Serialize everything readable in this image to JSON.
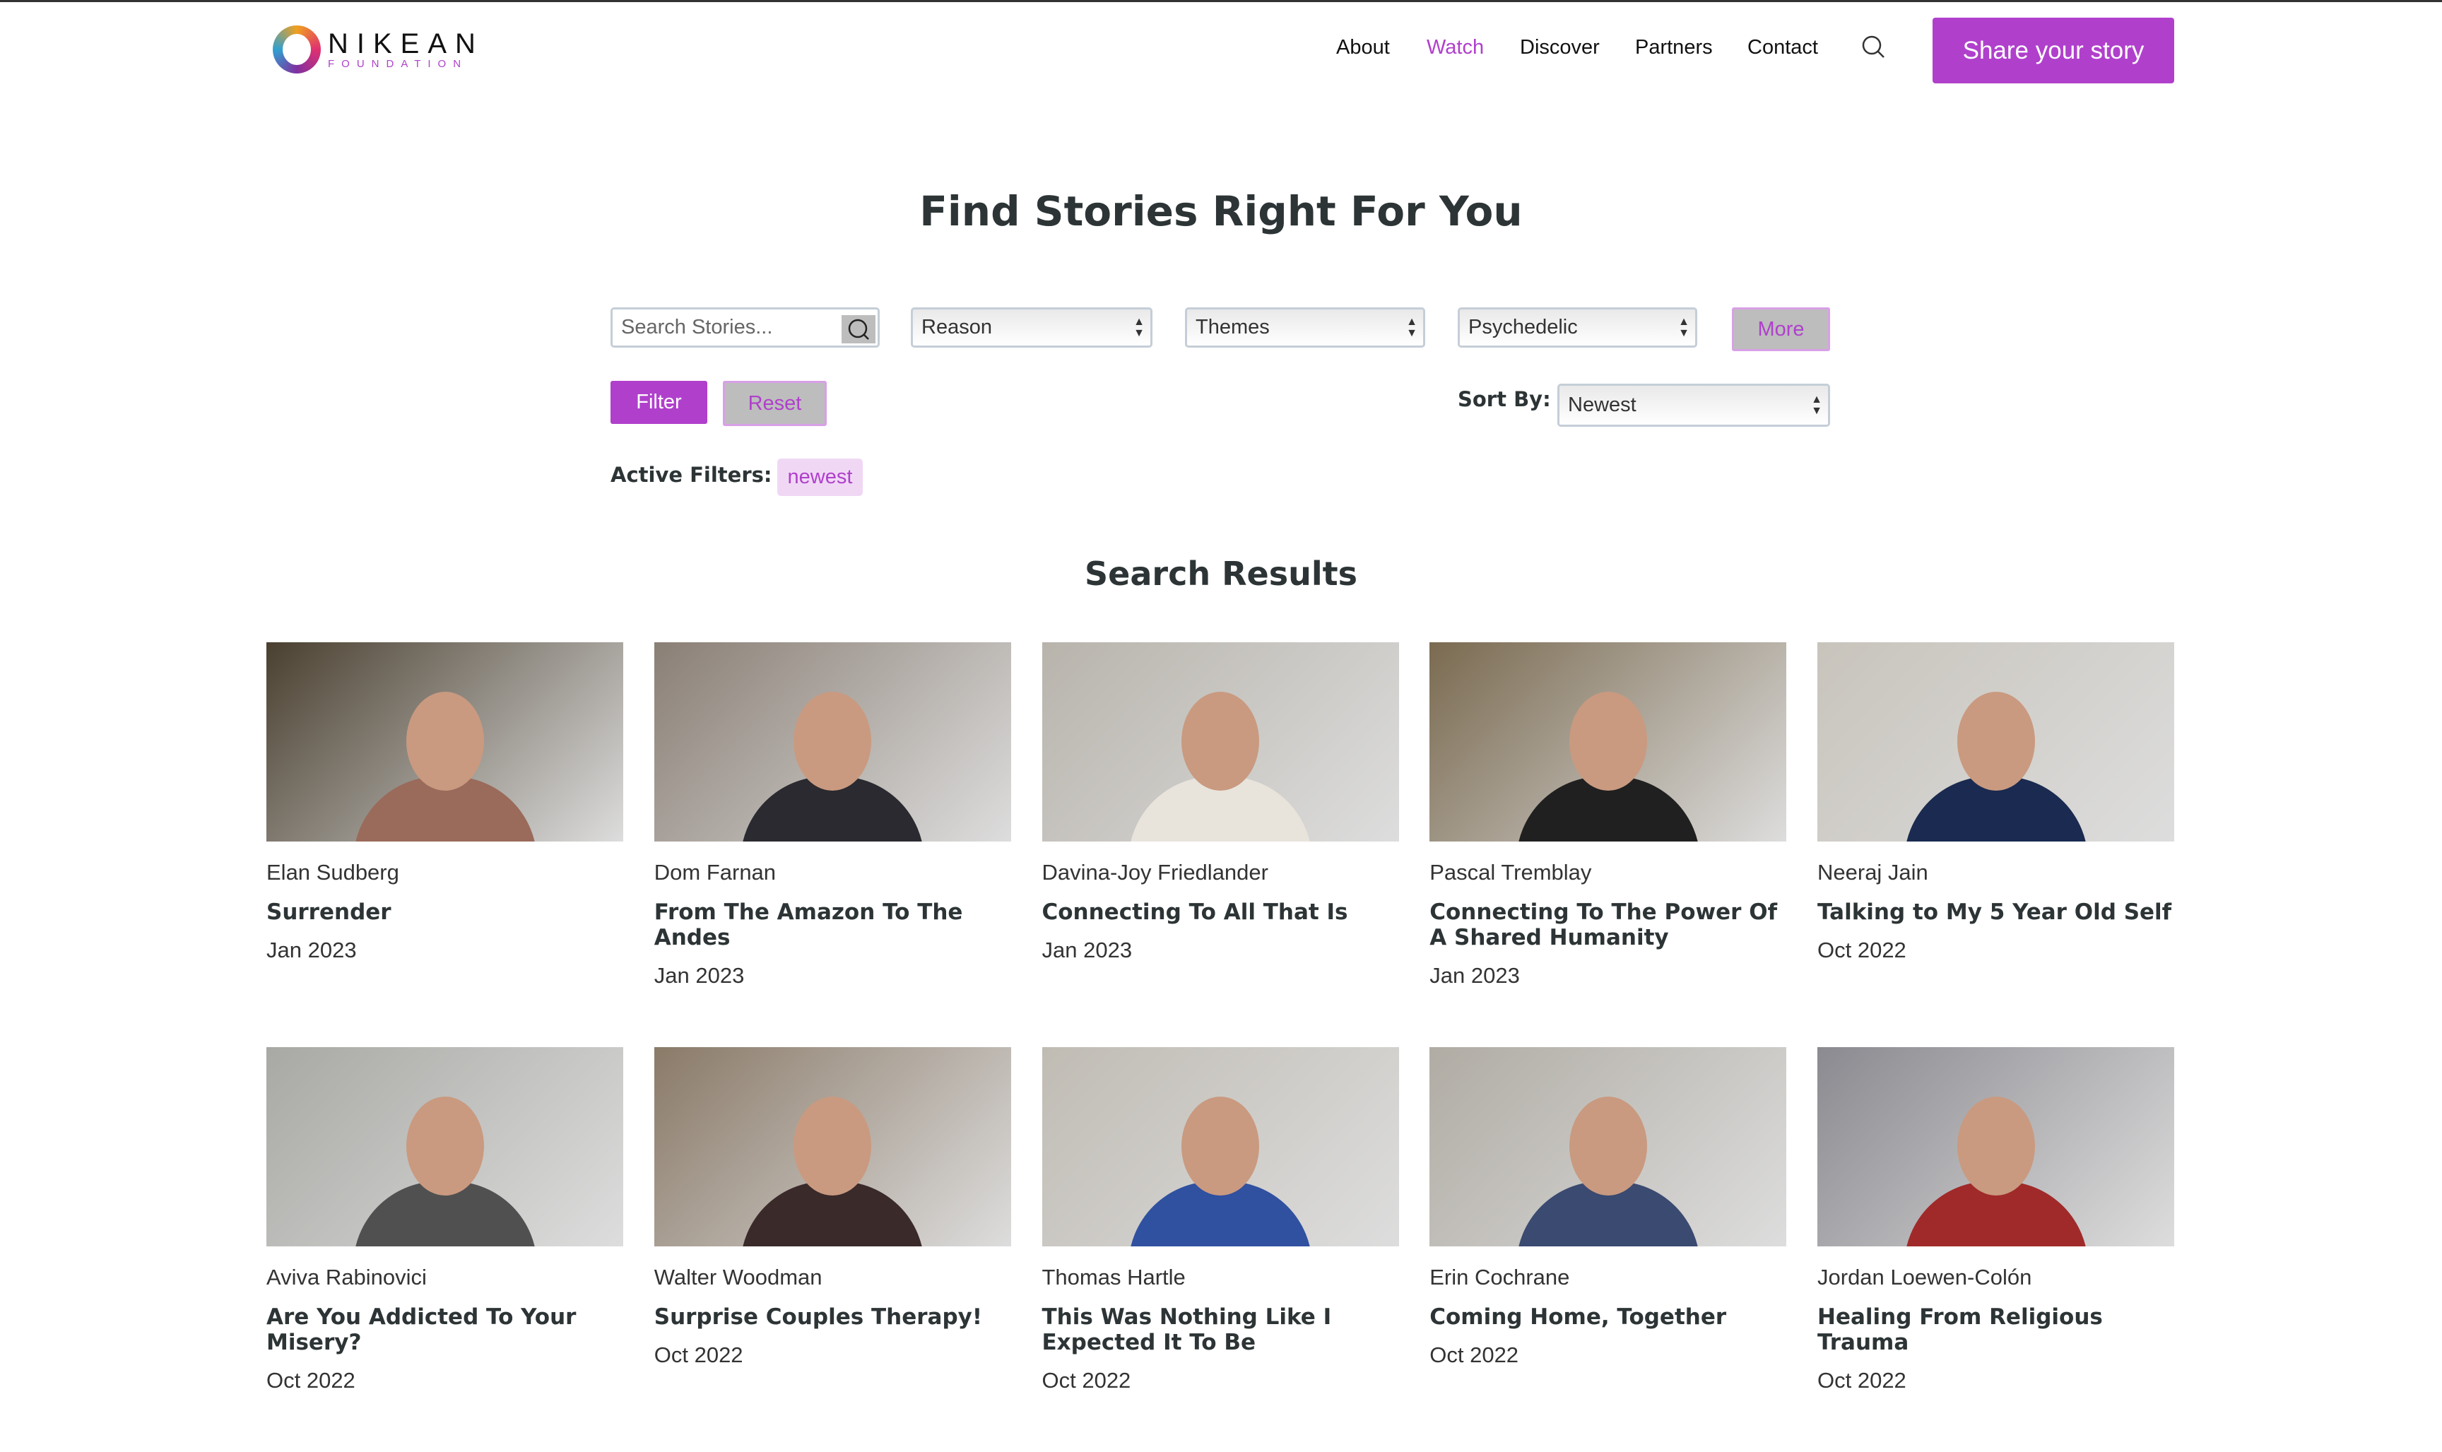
{
  "brand": {
    "name": "NIKEAN",
    "sub": "FOUNDATION"
  },
  "nav": {
    "items": [
      {
        "label": "About"
      },
      {
        "label": "Watch",
        "active": true
      },
      {
        "label": "Discover"
      },
      {
        "label": "Partners"
      },
      {
        "label": "Contact"
      }
    ],
    "cta": "Share your story"
  },
  "page_title": "Find Stories Right For You",
  "filters": {
    "search_placeholder": "Search Stories...",
    "reason": "Reason",
    "themes": "Themes",
    "psychedelic": "Psychedelic",
    "more": "More",
    "filter": "Filter",
    "reset": "Reset",
    "sort_label": "Sort By:",
    "sort_value": "Newest",
    "active_label": "Active Filters:",
    "active": [
      "newest"
    ]
  },
  "results_title": "Search Results",
  "accent": "#b040cc",
  "stories": [
    {
      "name": "Elan Sudberg",
      "title": "Surrender",
      "date": "Jan 2023",
      "bg": "#4a4030",
      "shirt": "#9a6a5a"
    },
    {
      "name": "Dom Farnan",
      "title": "From The Amazon To The Andes",
      "date": "Jan 2023",
      "bg": "#8a7f75",
      "shirt": "#2a2a30"
    },
    {
      "name": "Davina-Joy Friedlander",
      "title": "Connecting To All That Is",
      "date": "Jan 2023",
      "bg": "#b8b4ac",
      "shirt": "#e8e4dc"
    },
    {
      "name": "Pascal Tremblay",
      "title": "Connecting To The Power Of A Shared Humanity",
      "date": "Jan 2023",
      "bg": "#7a6a50",
      "shirt": "#202020"
    },
    {
      "name": "Neeraj Jain",
      "title": "Talking to My 5 Year Old Self",
      "date": "Oct 2022",
      "bg": "#c8c4bc",
      "shirt": "#1a2a50"
    },
    {
      "name": "Aviva Rabinovici",
      "title": "Are You Addicted To Your Misery?",
      "date": "Oct 2022",
      "bg": "#a8a8a4",
      "shirt": "#505050"
    },
    {
      "name": "Walter Woodman",
      "title": "Surprise Couples Therapy!",
      "date": "Oct 2022",
      "bg": "#8a7a68",
      "shirt": "#3a2a2a"
    },
    {
      "name": "Thomas Hartle",
      "title": "This Was Nothing Like I Expected It To Be",
      "date": "Oct 2022",
      "bg": "#c0bcb4",
      "shirt": "#3050a0"
    },
    {
      "name": "Erin Cochrane",
      "title": "Coming Home, Together",
      "date": "Oct 2022",
      "bg": "#b0aca4",
      "shirt": "#3a4a70"
    },
    {
      "name": "Jordan Loewen-Colón",
      "title": "Healing From Religious Trauma",
      "date": "Oct 2022",
      "bg": "#8a8a90",
      "shirt": "#a02a2a"
    }
  ]
}
